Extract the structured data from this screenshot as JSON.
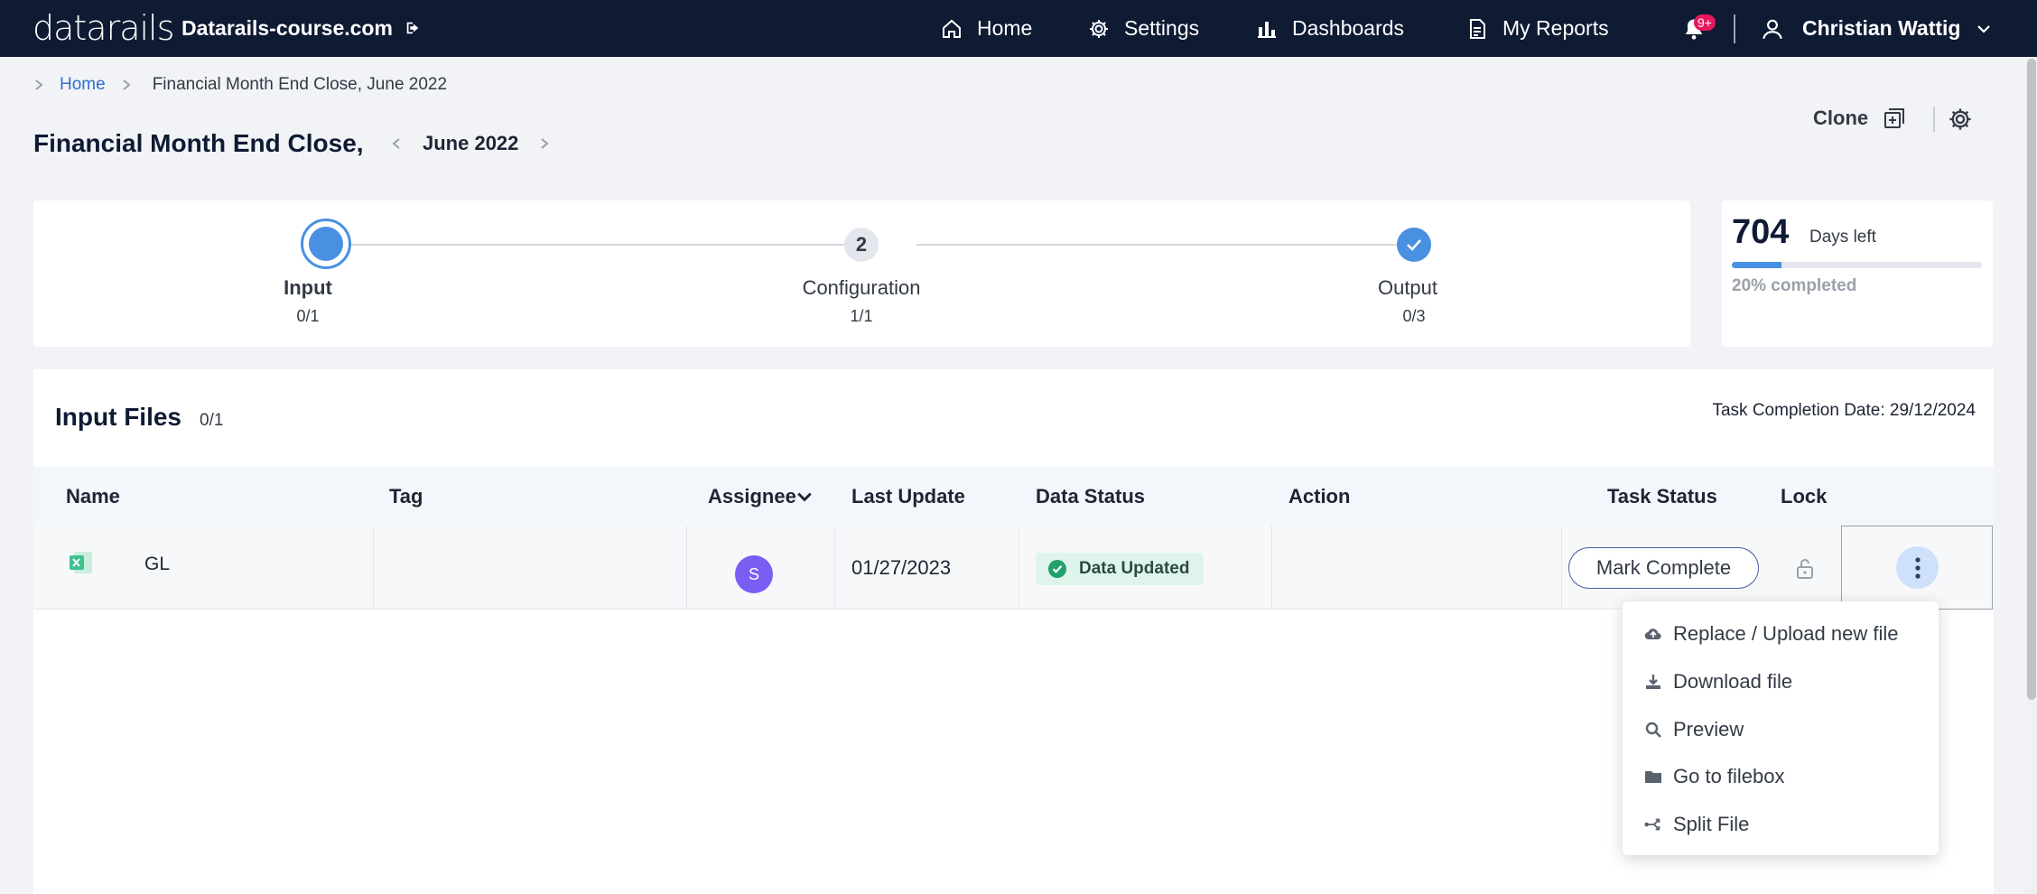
{
  "nav": {
    "logo": "datarails",
    "domain": "Datarails-course.com",
    "items": [
      {
        "label": "Home",
        "icon": "home-icon"
      },
      {
        "label": "Settings",
        "icon": "gear-icon"
      },
      {
        "label": "Dashboards",
        "icon": "bar-chart-icon"
      },
      {
        "label": "My Reports",
        "icon": "document-icon"
      }
    ],
    "notification_badge": "9+",
    "user_name": "Christian Wattig"
  },
  "breadcrumb": {
    "home": "Home",
    "current": "Financial Month End Close, June 2022"
  },
  "page": {
    "title": "Financial Month End Close,",
    "period": "June 2022",
    "clone_label": "Clone"
  },
  "stepper": {
    "steps": [
      {
        "label": "Input",
        "count": "0/1",
        "state": "active"
      },
      {
        "label": "Configuration",
        "count": "1/1",
        "state": "numbered",
        "number": "2"
      },
      {
        "label": "Output",
        "count": "0/3",
        "state": "done"
      }
    ]
  },
  "progress": {
    "days": "704",
    "days_label": "Days left",
    "percent": 20,
    "percent_label": "20% completed"
  },
  "input_files": {
    "title": "Input Files",
    "count": "0/1",
    "task_completion": "Task Completion Date: 29/12/2024",
    "columns": [
      "Name",
      "Tag",
      "Assignee",
      "Last Update",
      "Data Status",
      "Action",
      "Task Status",
      "Lock"
    ],
    "rows": [
      {
        "name": "GL",
        "tag": "",
        "assignee_initial": "S",
        "last_update": "01/27/2023",
        "data_status": "Data Updated",
        "task_status_button": "Mark Complete"
      }
    ]
  },
  "menu": {
    "items": [
      {
        "label": "Replace / Upload new file",
        "icon": "cloud-upload-icon"
      },
      {
        "label": "Download file",
        "icon": "download-icon"
      },
      {
        "label": "Preview",
        "icon": "search-icon"
      },
      {
        "label": "Go to filebox",
        "icon": "folder-icon"
      },
      {
        "label": "Split File",
        "icon": "split-icon"
      }
    ]
  },
  "colors": {
    "nav_bg": "#0f1a33",
    "accent": "#4a90e2",
    "badge": "#e8175d",
    "avatar": "#7a5df2",
    "success_bg": "#dff5ec",
    "success": "#22a06b"
  }
}
